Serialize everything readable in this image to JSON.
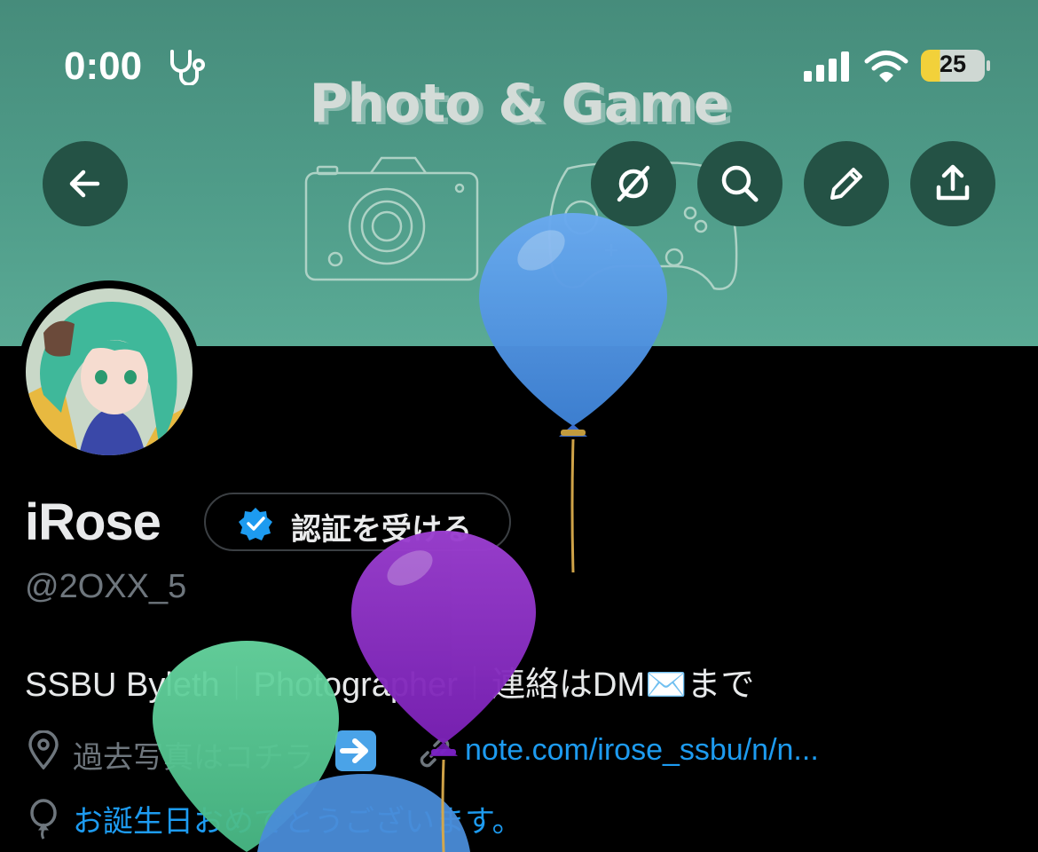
{
  "status_bar": {
    "time": "0:00",
    "battery_level": "25"
  },
  "banner": {
    "title": "Photo & Game"
  },
  "header_buttons": [
    "back-icon",
    "explore-icon",
    "search-icon",
    "edit-icon",
    "share-icon"
  ],
  "profile": {
    "display_name": "iRose",
    "verify_button_label": "認証を受ける",
    "handle": "@2OXX_5",
    "bio_part1": "SSBU Byleth",
    "bio_sep": "｜",
    "bio_part2": "Photographer",
    "bio_part3": "連絡はDM",
    "bio_emoji": "✉️",
    "bio_part4": "まで",
    "location_text": "過去写真はコチラ",
    "link_text": "note.com/irose_ssbu/n/n...",
    "birthday_text": "お誕生日おめでとうございます。"
  },
  "colors": {
    "banner": "#4f9c89",
    "button_bg": "#245245",
    "link_blue": "#1d9bf0",
    "balloon_blue": "#4a90d9",
    "balloon_purple": "#8a2fc0",
    "balloon_green": "#5fcf99"
  }
}
